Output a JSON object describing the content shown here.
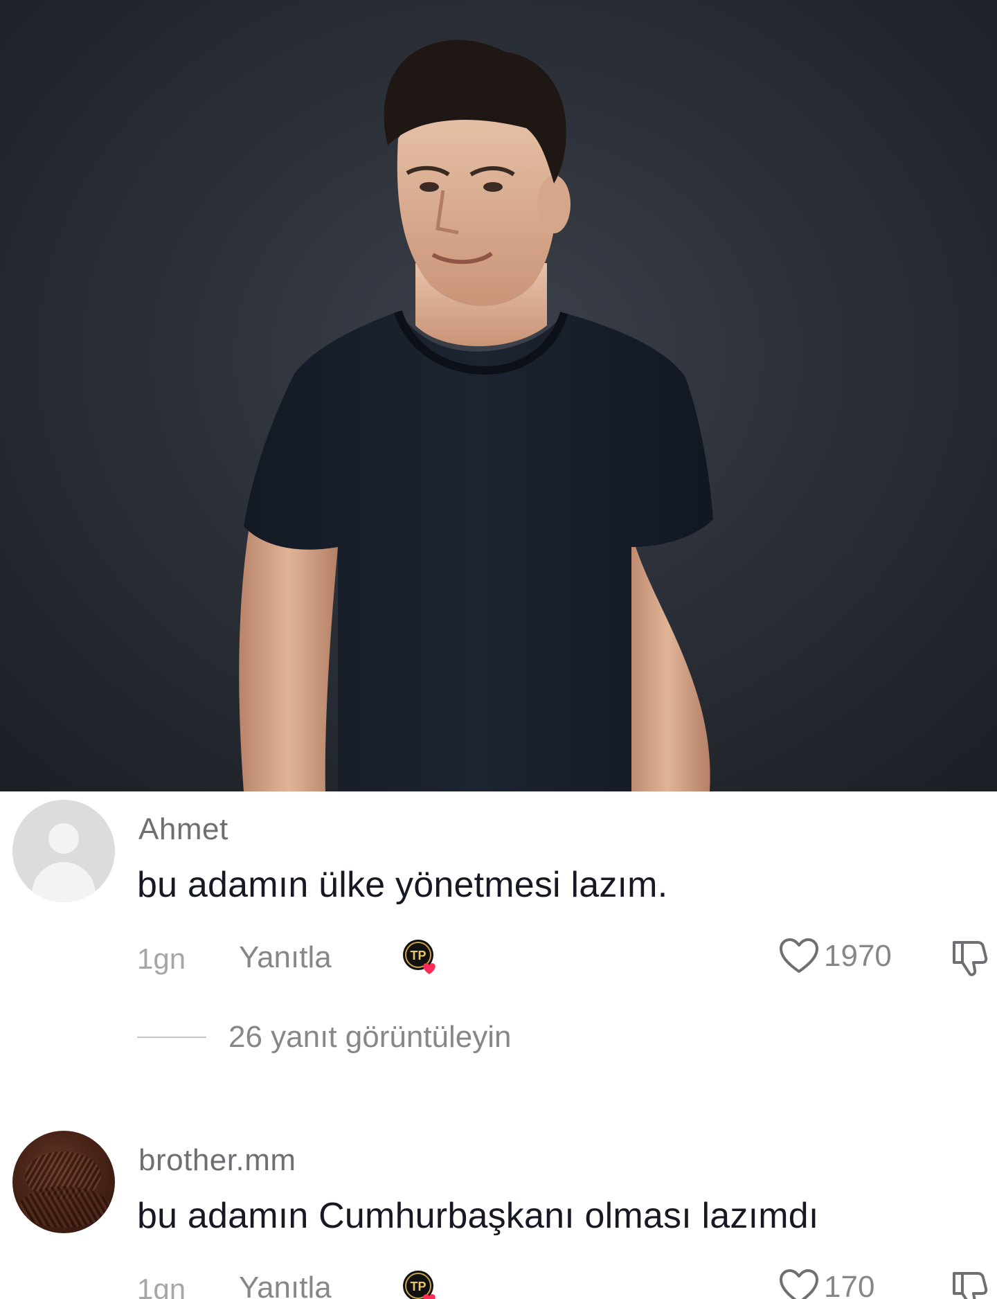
{
  "post": {
    "image_subject": "man-in-dark-tshirt"
  },
  "comments": [
    {
      "username": "Ahmet",
      "text": "bu adamın ülke yönetmesi lazım.",
      "time": "1gn",
      "reply_label": "Yanıtla",
      "creator_badge_text": "TP",
      "likes": "1970",
      "view_replies": "26 yanıt görüntüleyin",
      "avatar": "default-user-icon"
    },
    {
      "username": "brother.mm",
      "text": "bu adamın Cumhurbaşkanı olması lazımdı",
      "time": "1gn",
      "reply_label": "Yanıtla",
      "creator_badge_text": "TP",
      "likes": "170",
      "avatar": "photo-avatar"
    }
  ],
  "colors": {
    "background_photo": "#2c3038",
    "text_primary": "#161823",
    "text_secondary": "#86878b",
    "heart_badge": "#fe2c55"
  }
}
